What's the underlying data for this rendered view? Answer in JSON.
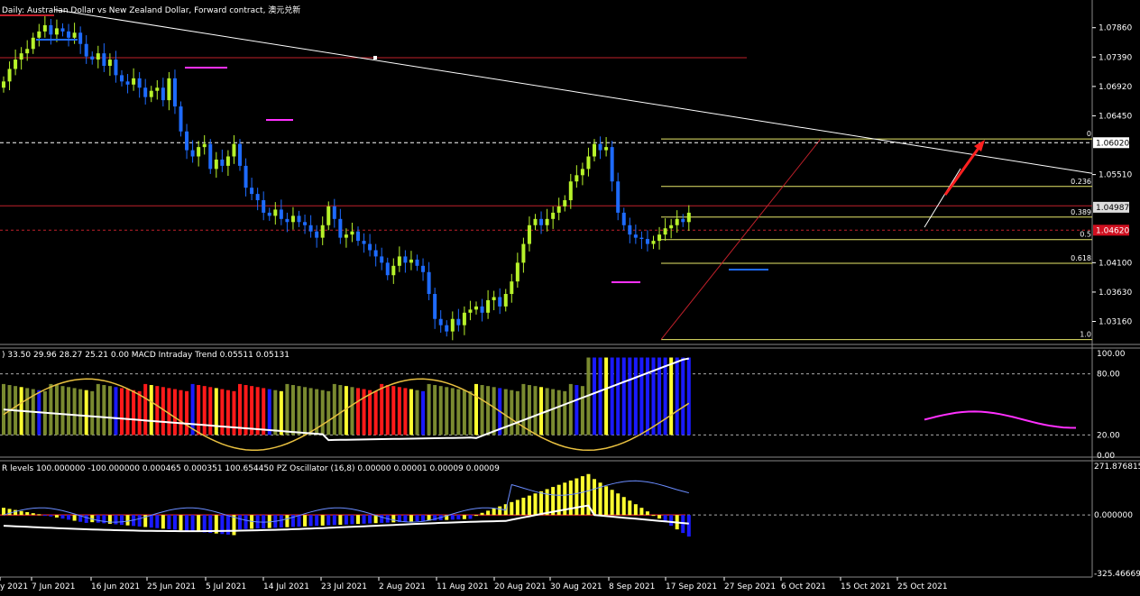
{
  "window": {
    "title": "Daily:  Australian Dollar vs New Zealand Dollar, Forward contract, 澳元兑新",
    "macd_panel_label": ") 33.50 29.96 28.27 25.21 0.00 MACD Intraday Trend  0.05511 0.05131",
    "osc_panel_label": "R levels 100.000000 -100.000000 0.000465 0.000351 100.654450 PZ Oscillator (16,8) 0.00000 0.00001 0.00009 0.00009"
  },
  "colors": {
    "background": "#000000",
    "bull_candle": "#b7f22a",
    "bear_candle": "#1e6bff",
    "trendline": "#ffffff",
    "fib": "#e8e86a",
    "resistance": "#c0202a",
    "arrow": "#ff2020",
    "hist_red": "#ff1a1a",
    "hist_olive": "#7a8a30",
    "hist_blue": "#1a1aff",
    "hist_yellow": "#ffff30",
    "magenta": "#ff30ff"
  },
  "chart_data": [
    {
      "type": "candlestick",
      "title": "Daily:  Australian Dollar vs New Zealand Dollar, Forward contract, 澳元兑新",
      "y_ticks": [
        "1.07860",
        "1.07390",
        "1.06920",
        "1.06450",
        "1.05510",
        "1.04100",
        "1.03630",
        "1.03160"
      ],
      "ylim": [
        1.0285,
        1.0813
      ],
      "x_ticks": [
        "y 2021",
        "7 Jun 2021",
        "16 Jun 2021",
        "25 Jun 2021",
        "5 Jul 2021",
        "14 Jul 2021",
        "23 Jul 2021",
        "2 Aug 2021",
        "11 Aug 2021",
        "20 Aug 2021",
        "30 Aug 2021",
        "8 Sep 2021",
        "17 Sep 2021",
        "27 Sep 2021",
        "6 Oct 2021",
        "15 Oct 2021",
        "25 Oct 2021"
      ],
      "price_tags": [
        {
          "label": "1.06020",
          "value": 1.0602,
          "style": "current"
        },
        {
          "label": "1.04987",
          "value": 1.04987,
          "style": "bid"
        },
        {
          "label": "1.04620",
          "value": 1.0462,
          "style": "alert"
        }
      ],
      "fibonacci": {
        "levels": [
          "0",
          "0.236",
          "0.389",
          "0.5",
          "0.618",
          "1.0"
        ],
        "prices": [
          1.0608,
          1.0532,
          1.0483,
          1.0447,
          1.0409,
          1.0287
        ]
      },
      "resistance_lines": [
        1.0738,
        1.0501
      ],
      "trendline": {
        "from": {
          "date": "3 Jun 2021",
          "price": 1.0815
        },
        "to": {
          "date": "1 Nov 2021",
          "price": 1.0553
        }
      },
      "closes": [
        1.07,
        1.072,
        1.0735,
        1.0745,
        1.0752,
        1.077,
        1.078,
        1.079,
        1.0775,
        1.0785,
        1.078,
        1.077,
        1.0778,
        1.076,
        1.074,
        1.0735,
        1.0745,
        1.0725,
        1.0735,
        1.071,
        1.07,
        1.0695,
        1.0705,
        1.069,
        1.0675,
        1.0685,
        1.069,
        1.067,
        1.0705,
        1.066,
        1.062,
        1.059,
        1.058,
        1.0595,
        1.06,
        1.056,
        1.0575,
        1.0565,
        1.058,
        1.06,
        1.0565,
        1.053,
        1.052,
        1.051,
        1.049,
        1.0485,
        1.0495,
        1.048,
        1.0475,
        1.0485,
        1.0475,
        1.047,
        1.046,
        1.045,
        1.047,
        1.05,
        1.048,
        1.045,
        1.0455,
        1.046,
        1.0445,
        1.044,
        1.043,
        1.042,
        1.041,
        1.039,
        1.0405,
        1.042,
        1.041,
        1.0415,
        1.0405,
        1.0395,
        1.036,
        1.032,
        1.031,
        1.03,
        1.032,
        1.031,
        1.033,
        1.0335,
        1.034,
        1.033,
        1.035,
        1.0355,
        1.034,
        1.036,
        1.038,
        1.041,
        1.044,
        1.047,
        1.048,
        1.047,
        1.048,
        1.049,
        1.05,
        1.051,
        1.054,
        1.055,
        1.056,
        1.058,
        1.06,
        1.059,
        1.0595,
        1.054,
        1.049,
        1.047,
        1.0455,
        1.045,
        1.0448,
        1.044,
        1.0445,
        1.0455,
        1.0465,
        1.047,
        1.048,
        1.0475,
        1.049
      ],
      "macd_panel": {
        "y_ticks": [
          "100.00",
          "80.00",
          "20.00",
          "0.00"
        ],
        "ylim": [
          0,
          100
        ]
      },
      "osc_panel": {
        "y_ticks": [
          "271.876815",
          "0.000000",
          "-325.466691"
        ],
        "ylim": [
          -325.466691,
          271.876815
        ]
      }
    }
  ]
}
